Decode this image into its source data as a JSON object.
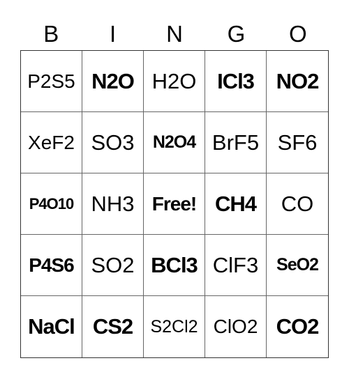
{
  "header": [
    "B",
    "I",
    "N",
    "G",
    "O"
  ],
  "cells": [
    {
      "text": "P2S5",
      "bold": false,
      "size": "m"
    },
    {
      "text": "N2O",
      "bold": true,
      "size": "l"
    },
    {
      "text": "H2O",
      "bold": false,
      "size": "l"
    },
    {
      "text": "ICl3",
      "bold": true,
      "size": "l"
    },
    {
      "text": "NO2",
      "bold": true,
      "size": "l"
    },
    {
      "text": "XeF2",
      "bold": false,
      "size": "m"
    },
    {
      "text": "SO3",
      "bold": false,
      "size": "l"
    },
    {
      "text": "N2O4",
      "bold": true,
      "size": "s"
    },
    {
      "text": "BrF5",
      "bold": false,
      "size": "l"
    },
    {
      "text": "SF6",
      "bold": false,
      "size": "l"
    },
    {
      "text": "P4O10",
      "bold": true,
      "size": "xs"
    },
    {
      "text": "NH3",
      "bold": false,
      "size": "l"
    },
    {
      "text": "Free!",
      "bold": true,
      "size": "m"
    },
    {
      "text": "CH4",
      "bold": true,
      "size": "l"
    },
    {
      "text": "CO",
      "bold": false,
      "size": "l"
    },
    {
      "text": "P4S6",
      "bold": true,
      "size": "m"
    },
    {
      "text": "SO2",
      "bold": false,
      "size": "l"
    },
    {
      "text": "BCl3",
      "bold": true,
      "size": "l"
    },
    {
      "text": "ClF3",
      "bold": false,
      "size": "l"
    },
    {
      "text": "SeO2",
      "bold": true,
      "size": "s"
    },
    {
      "text": "NaCl",
      "bold": true,
      "size": "l"
    },
    {
      "text": "CS2",
      "bold": true,
      "size": "l"
    },
    {
      "text": "S2Cl2",
      "bold": false,
      "size": "s"
    },
    {
      "text": "ClO2",
      "bold": false,
      "size": "m"
    },
    {
      "text": "CO2",
      "bold": true,
      "size": "l"
    }
  ]
}
